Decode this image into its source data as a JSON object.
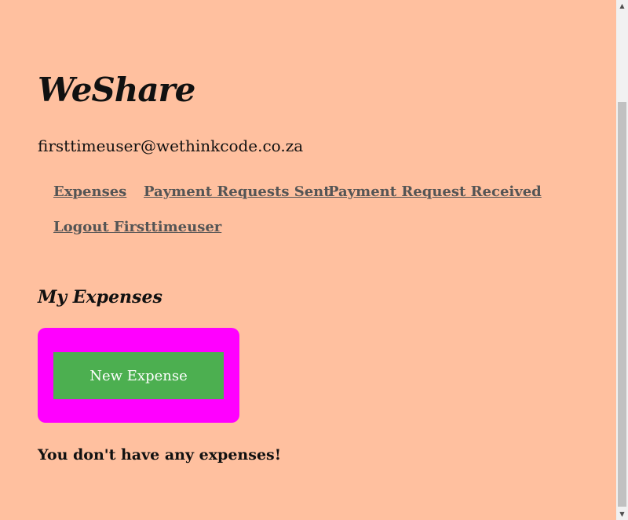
{
  "app": {
    "title": "WeShare",
    "user_email": "firsttimeuser@wethinkcode.co.za"
  },
  "nav": {
    "items": [
      {
        "label": "Expenses"
      },
      {
        "label": "Payment Requests Sent"
      },
      {
        "label": "Payment Request Received"
      },
      {
        "label": "Logout Firsttimeuser"
      }
    ]
  },
  "expenses": {
    "heading": "My Expenses",
    "new_button_label": "New Expense",
    "empty_message": "You don't have any expenses!"
  },
  "colors": {
    "background": "#ffc09f",
    "button_container": "#ff00ff",
    "button": "#4caf50",
    "link": "#555555"
  },
  "icons": {
    "scroll_up": "triangle-up-icon",
    "scroll_down": "triangle-down-icon"
  }
}
